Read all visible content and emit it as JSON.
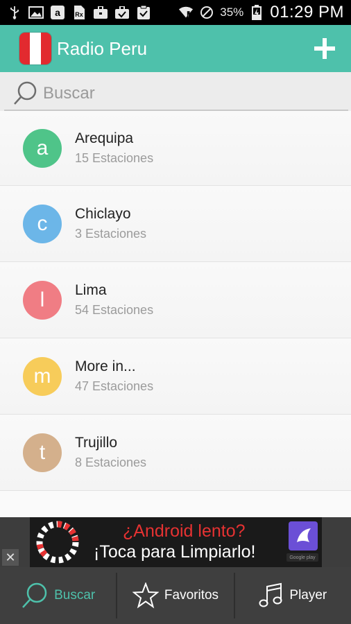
{
  "status_bar": {
    "icons": [
      "usb-icon",
      "image-icon",
      "amazon-icon",
      "rx-icon",
      "briefcase-icon",
      "briefcase-check-icon",
      "clipboard-check-icon",
      "wifi-icon",
      "do-not-disturb-icon",
      "battery-icon"
    ],
    "battery": "35%",
    "time": "01:29 PM"
  },
  "app_bar": {
    "title": "Radio Peru",
    "color": "#4ec1ab",
    "flag_colors": [
      "#e22a2f",
      "#ffffff",
      "#e22a2f"
    ],
    "action_icon": "plus-icon"
  },
  "search": {
    "placeholder": "Buscar",
    "icon": "search-icon"
  },
  "cities": [
    {
      "letter": "a",
      "name": "Arequipa",
      "count": "15 Estaciones",
      "color": "#4fc489"
    },
    {
      "letter": "c",
      "name": "Chiclayo",
      "count": "3 Estaciones",
      "color": "#6cb6e8"
    },
    {
      "letter": "l",
      "name": "Lima",
      "count": "54 Estaciones",
      "color": "#f07d84"
    },
    {
      "letter": "m",
      "name": "More in...",
      "count": "47 Estaciones",
      "color": "#f7cc5a"
    },
    {
      "letter": "t",
      "name": "Trujillo",
      "count": "8 Estaciones",
      "color": "#d4b08c"
    }
  ],
  "ad": {
    "line1": "¿Android lento?",
    "line2": "¡Toca para Limpiarlo!",
    "close": "✕",
    "store_badge": "Google play"
  },
  "bottom_nav": {
    "tabs": [
      {
        "label": "Buscar",
        "icon": "search-icon",
        "active": true
      },
      {
        "label": "Favoritos",
        "icon": "star-icon",
        "active": false
      },
      {
        "label": "Player",
        "icon": "music-note-icon",
        "active": false
      }
    ],
    "active_color": "#4ec1ab"
  }
}
